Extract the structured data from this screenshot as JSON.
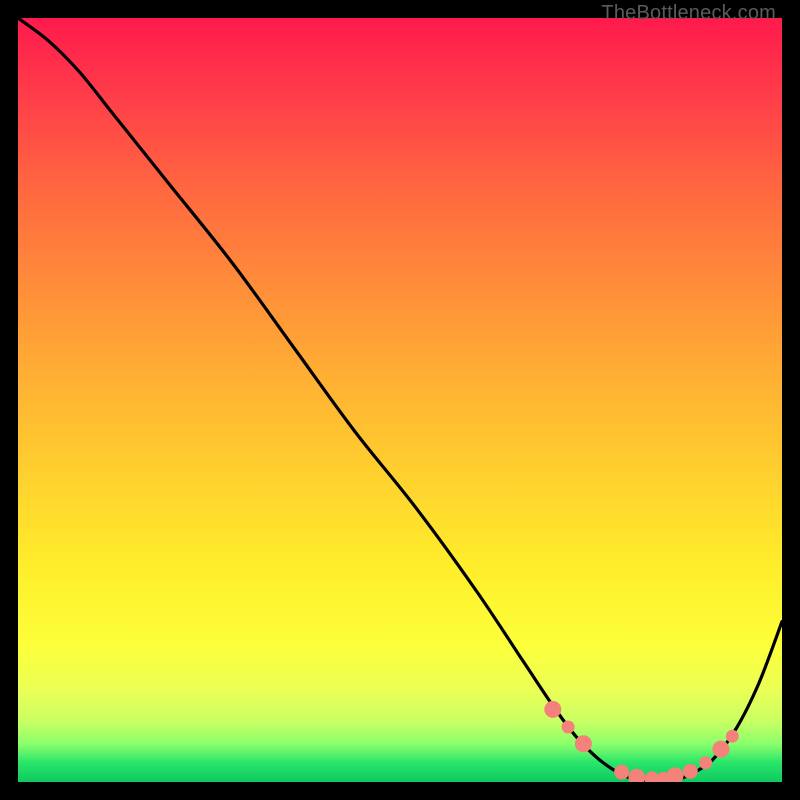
{
  "watermark": "TheBottleneck.com",
  "colors": {
    "curve": "#000000",
    "marker_fill": "#f4817a",
    "marker_stroke": "#f4817a",
    "frame_bg": "#000000"
  },
  "chart_data": {
    "type": "line",
    "title": "",
    "xlabel": "",
    "ylabel": "",
    "xlim": [
      0,
      100
    ],
    "ylim": [
      0,
      100
    ],
    "grid": false,
    "legend": false,
    "series": [
      {
        "name": "bottleneck-curve",
        "x": [
          0,
          4,
          8,
          12,
          16,
          20,
          28,
          36,
          44,
          52,
          60,
          66,
          70,
          73,
          76,
          79,
          82,
          85,
          88,
          91,
          94,
          97,
          100
        ],
        "y": [
          100,
          97,
          93,
          88,
          83,
          78,
          68,
          57,
          46,
          36,
          25,
          16,
          10,
          6,
          3,
          1,
          0,
          0,
          1,
          3,
          7,
          13,
          21
        ]
      }
    ],
    "markers": {
      "name": "highlighted-points",
      "x": [
        70,
        72,
        74,
        79,
        81,
        83,
        84.5,
        86,
        88,
        90,
        92,
        93.5
      ],
      "y": [
        9.5,
        7.2,
        5.0,
        1.3,
        0.6,
        0.4,
        0.5,
        0.8,
        1.4,
        2.5,
        4.3,
        6.0
      ],
      "r": [
        8,
        6,
        8,
        7,
        8,
        7,
        6,
        8,
        7,
        6,
        8,
        6
      ]
    }
  }
}
